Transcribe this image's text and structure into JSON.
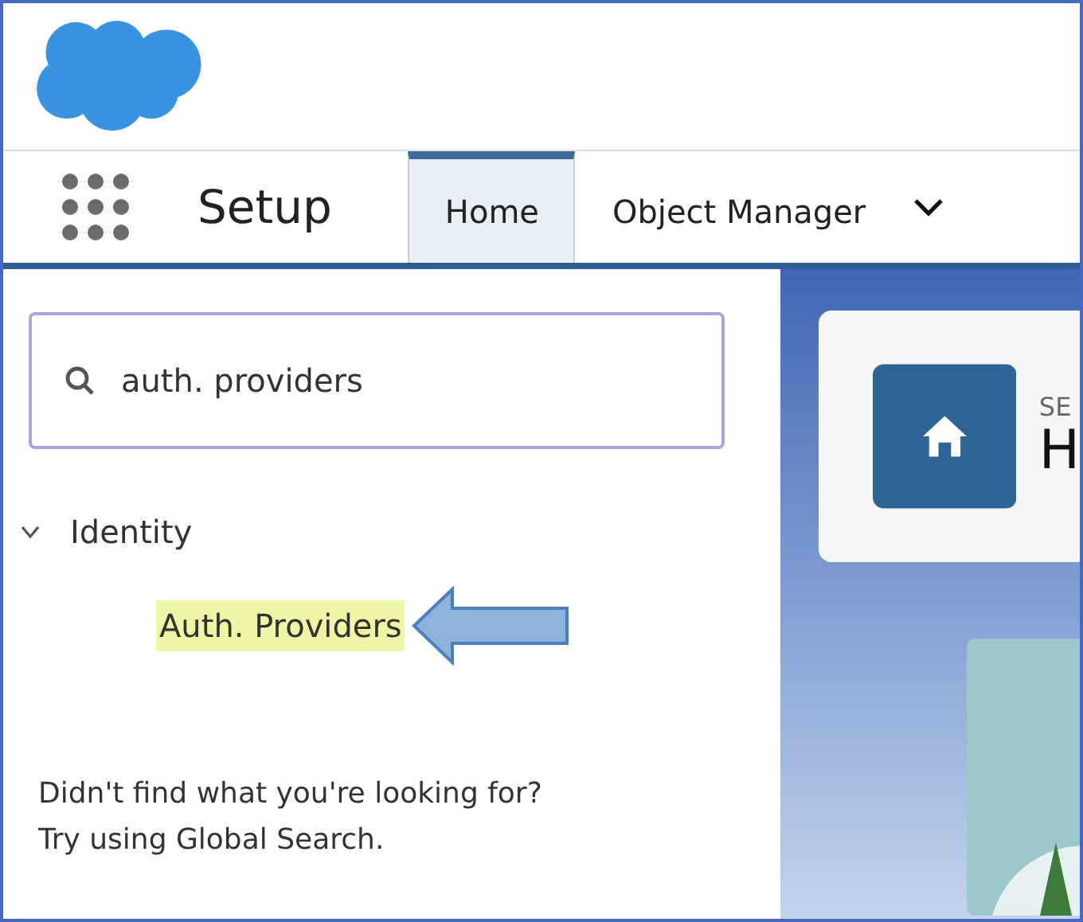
{
  "app": {
    "title": "Setup"
  },
  "tabs": [
    {
      "label": "Home",
      "selected": true,
      "menu": false
    },
    {
      "label": "Object Manager",
      "selected": false,
      "menu": true
    }
  ],
  "quick_find": {
    "value": "auth. providers"
  },
  "tree": [
    {
      "label": "Identity",
      "expanded": true,
      "children": [
        {
          "label": "Auth. Providers",
          "highlighted": true
        }
      ]
    }
  ],
  "annotation_arrow": true,
  "no_results_hint": [
    "Didn't find what you're looking for?",
    "Try using Global Search."
  ],
  "page_header": {
    "eyebrow": "SE",
    "title": "H"
  }
}
